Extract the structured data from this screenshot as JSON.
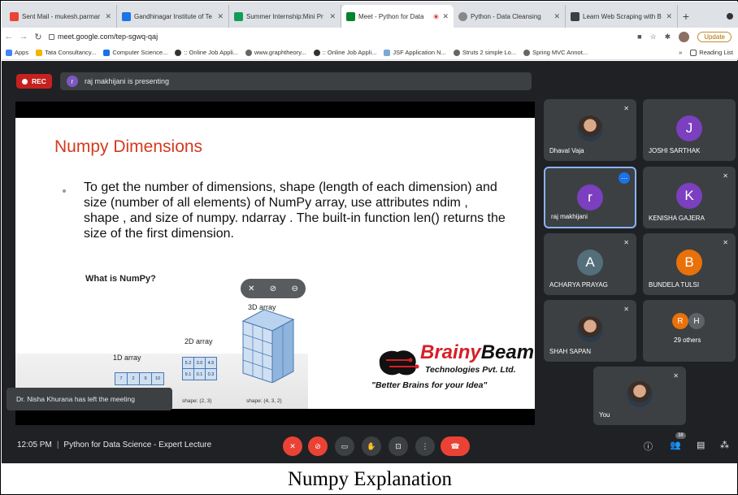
{
  "browser": {
    "tabs": [
      {
        "label": "Sent Mail - mukesh.parmar",
        "color": "#ea4335"
      },
      {
        "label": "Gandhinagar Institute of Te",
        "color": "#1a73e8"
      },
      {
        "label": "Summer Internship:Mini Pr",
        "color": "#0f9d58"
      },
      {
        "label": "Meet - Python for Data",
        "color": "#00832d",
        "active": true
      },
      {
        "label": "Python - Data Cleansing",
        "color": "#888888"
      },
      {
        "label": "Learn Web Scraping with B",
        "color": "#3c4043"
      }
    ],
    "url": "meet.google.com/tep-sgwq-qaj",
    "update_label": "Update",
    "bookmarks": [
      "Apps",
      "Tata Consultancy...",
      "Computer Science...",
      ":: Online Job Appli...",
      "www.graphtheory...",
      ":: Online Job Appli...",
      "JSF Application N...",
      "Struts 2 simple Lo...",
      "Spring MVC Annot..."
    ],
    "more_bookmarks": "»",
    "reading_list": "Reading List"
  },
  "meet": {
    "rec_label": "REC",
    "presenter_initial": "r",
    "presenting_text": "raj makhijani is presenting",
    "toast": "Dr. Nisha Khurana has left the meeting",
    "meeting_time": "12:05 PM",
    "meeting_title": "Python for Data Science - Expert Lecture",
    "participant_count": "38"
  },
  "slide": {
    "title": "Numpy Dimensions",
    "bullet": "To get the number of dimensions, shape (length of each dimension) and size (number of all elements) of NumPy array, use attributes ndim , shape , and size of numpy. ndarray . The built-in function len() returns the size of the first dimension.",
    "what_is": "What is NumPy?",
    "label_1d": "1D array",
    "label_2d": "2D array",
    "label_3d": "3D array",
    "cells_1d": [
      "7",
      "2",
      "9",
      "10"
    ],
    "cells_2d": [
      "5.2",
      "3.0",
      "4.5",
      "9.1",
      "0.1",
      "0.3"
    ],
    "shape_2d": "shape: (2, 3)",
    "shape_3d": "shape: (4, 3, 2)",
    "logo_brand": "Brainy",
    "logo_brand2": "Beam",
    "logo_company": "Technologies Pvt. Ltd.",
    "logo_tagline": "\"Better Brains for your Idea\""
  },
  "participants": [
    {
      "name": "Dhaval Vaja",
      "initial": "",
      "photo": true
    },
    {
      "name": "JOSHI SARTHAK",
      "initial": "J",
      "color": "#7b3fbf"
    },
    {
      "name": "raj makhijani",
      "initial": "r",
      "color": "#7b3fbf",
      "active": true
    },
    {
      "name": "KENISHA GAJERA",
      "initial": "K",
      "color": "#7b3fbf"
    },
    {
      "name": "ACHARYA PRAYAG",
      "initial": "A",
      "color": "#546e7a"
    },
    {
      "name": "BUNDELA TULSI",
      "initial": "B",
      "color": "#e8710a"
    },
    {
      "name": "SHAH SAPAN",
      "initial": "",
      "photo": true
    },
    {
      "name": "29 others",
      "initials": [
        "R",
        "H"
      ]
    },
    {
      "name": "You",
      "initial": "",
      "photo": true
    }
  ],
  "caption": "Numpy Explanation"
}
